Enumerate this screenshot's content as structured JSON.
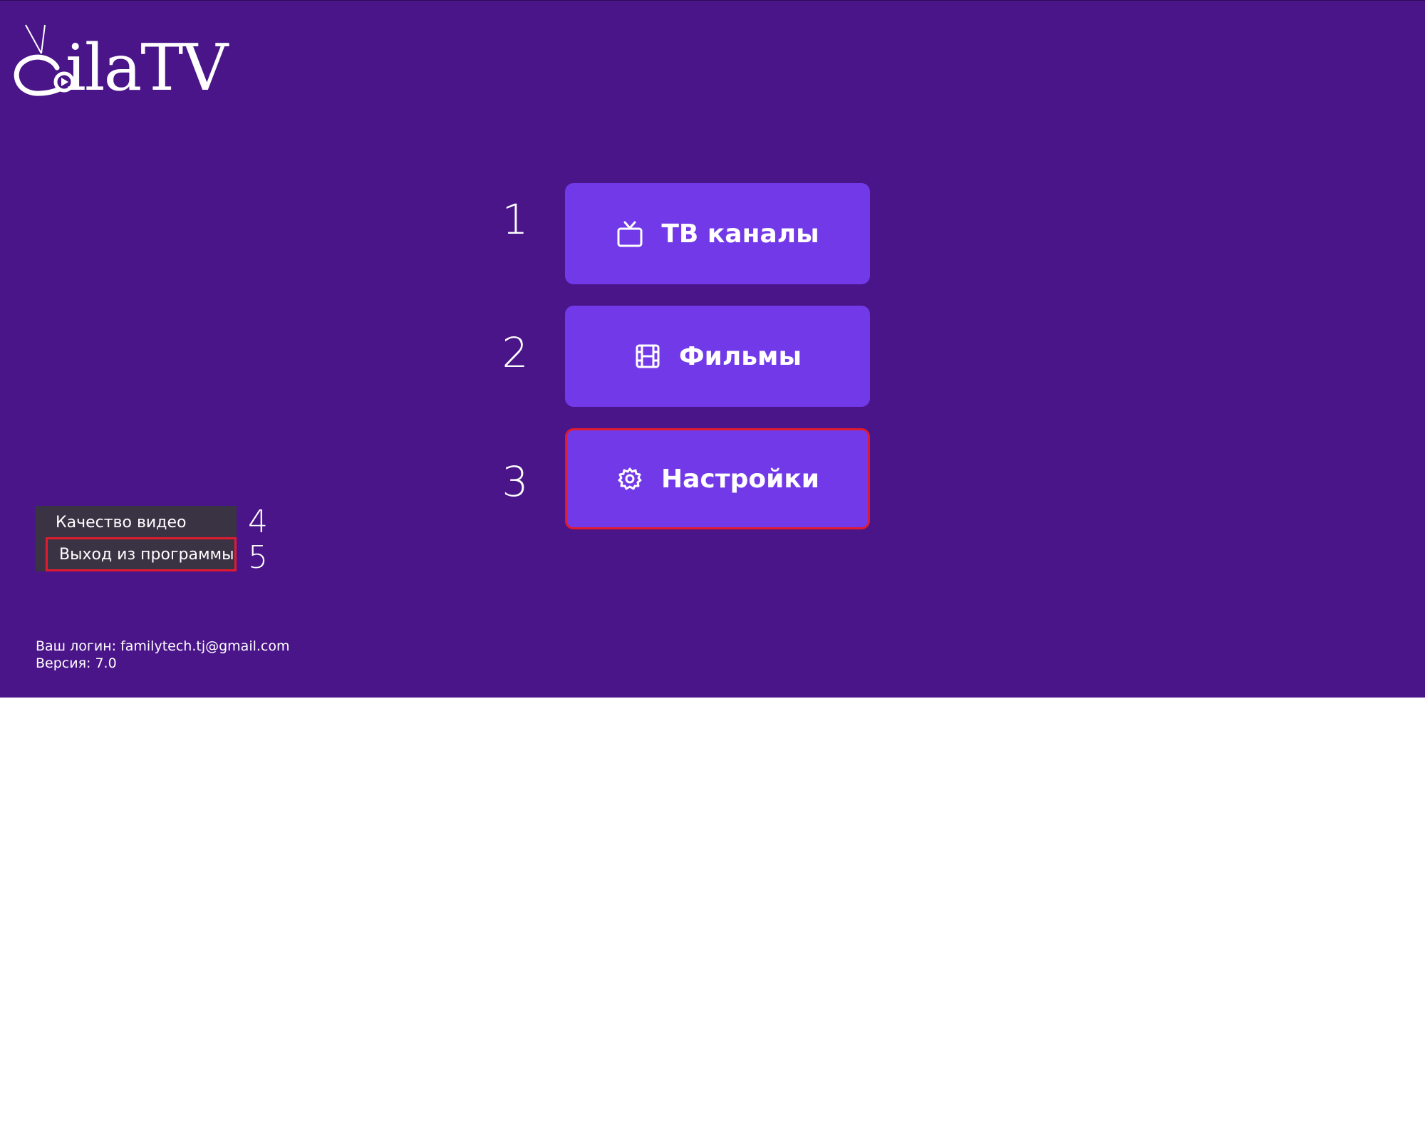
{
  "app": {
    "logo_text": "ilaTV",
    "colors": {
      "background": "#4a1589",
      "button": "#7239e8",
      "focus": "#e01b2f",
      "side_menu": "#3a3344"
    }
  },
  "main_menu": [
    {
      "number": "1",
      "label": "ТВ каналы",
      "icon": "tv-icon"
    },
    {
      "number": "2",
      "label": "Фильмы",
      "icon": "film-icon"
    },
    {
      "number": "3",
      "label": "Настройки",
      "icon": "gear-icon",
      "focused": true
    }
  ],
  "side_menu": [
    {
      "number": "4",
      "label": "Качество видео"
    },
    {
      "number": "5",
      "label": "Выход из программы",
      "focused": true
    }
  ],
  "footer": {
    "login_line": "Ваш логин: familytech.tj@gmail.com",
    "version_line": "Версия: 7.0"
  }
}
